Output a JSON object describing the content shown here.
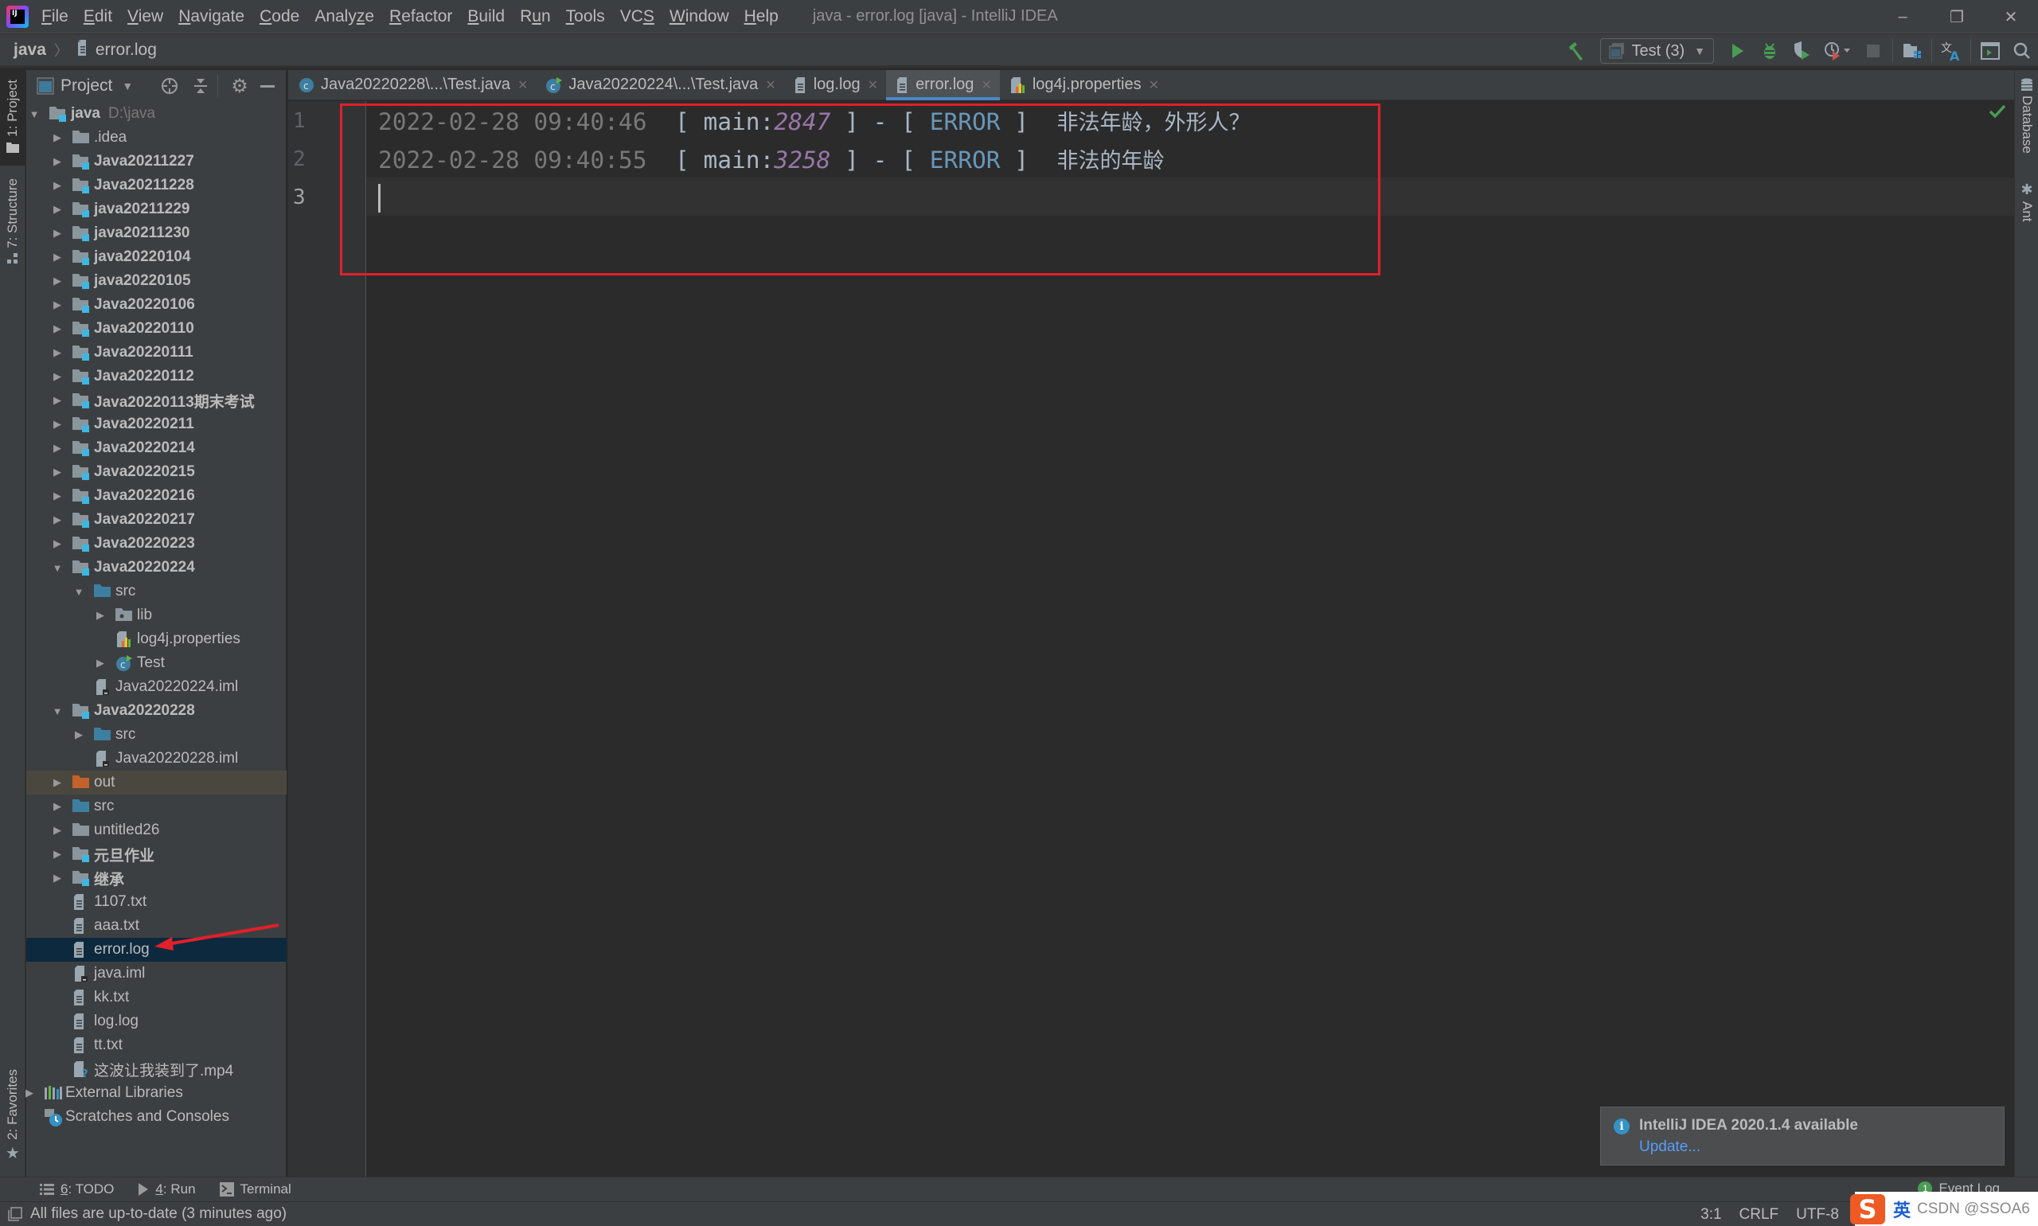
{
  "window": {
    "title": "java - error.log [java] - IntelliJ IDEA",
    "logo_text": "IJ",
    "controls": {
      "minimize": "–",
      "restore": "❐",
      "close": "✕"
    }
  },
  "menu": [
    {
      "label": "File",
      "mnemonic": "F",
      "rest": "ile"
    },
    {
      "label": "Edit",
      "mnemonic": "E",
      "rest": "dit"
    },
    {
      "label": "View",
      "mnemonic": "V",
      "rest": "iew"
    },
    {
      "label": "Navigate",
      "mnemonic": "N",
      "rest": "avigate"
    },
    {
      "label": "Code",
      "mnemonic": "C",
      "rest": "ode"
    },
    {
      "label": "Analyze",
      "pre": "Analy",
      "mnemonic": "z",
      "rest": "e"
    },
    {
      "label": "Refactor",
      "mnemonic": "R",
      "rest": "efactor"
    },
    {
      "label": "Build",
      "mnemonic": "B",
      "rest": "uild"
    },
    {
      "label": "Run",
      "pre": "R",
      "mnemonic": "u",
      "rest": "n"
    },
    {
      "label": "Tools",
      "mnemonic": "T",
      "rest": "ools"
    },
    {
      "label": "VCS",
      "pre": "VC",
      "mnemonic": "S",
      "rest": ""
    },
    {
      "label": "Window",
      "mnemonic": "W",
      "rest": "indow"
    },
    {
      "label": "Help",
      "mnemonic": "H",
      "rest": "elp"
    }
  ],
  "breadcrumb": {
    "root": "java",
    "separator": "〉",
    "file": "error.log"
  },
  "toolbar": {
    "run_config": "Test (3)",
    "icons": [
      "build-hammer-icon",
      "run-icon",
      "debug-icon",
      "coverage-icon",
      "profile-icon",
      "stop-icon",
      "project-structure-icon",
      "translate-icon",
      "terminal-window-icon",
      "search-icon"
    ]
  },
  "left_strip": {
    "project_tab": "1: Project",
    "structure_tab": "7: Structure",
    "favorites_tab": "2: Favorites"
  },
  "project_panel": {
    "title": "Project",
    "tree": [
      {
        "depth": 0,
        "label": "java",
        "hint": "D:\\java",
        "type": "module",
        "expanded": true,
        "bold": true
      },
      {
        "depth": 1,
        "label": ".idea",
        "type": "folder",
        "expandable": true
      },
      {
        "depth": 1,
        "label": "Java20211227",
        "type": "module",
        "expandable": true,
        "bold": true
      },
      {
        "depth": 1,
        "label": "Java20211228",
        "type": "module",
        "expandable": true,
        "bold": true
      },
      {
        "depth": 1,
        "label": "java20211229",
        "type": "module",
        "expandable": true,
        "bold": true
      },
      {
        "depth": 1,
        "label": "java20211230",
        "type": "module",
        "expandable": true,
        "bold": true
      },
      {
        "depth": 1,
        "label": "java20220104",
        "type": "module",
        "expandable": true,
        "bold": true
      },
      {
        "depth": 1,
        "label": "java20220105",
        "type": "module",
        "expandable": true,
        "bold": true
      },
      {
        "depth": 1,
        "label": "Java20220106",
        "type": "module",
        "expandable": true,
        "bold": true
      },
      {
        "depth": 1,
        "label": "Java20220110",
        "type": "module",
        "expandable": true,
        "bold": true
      },
      {
        "depth": 1,
        "label": "Java20220111",
        "type": "module",
        "expandable": true,
        "bold": true
      },
      {
        "depth": 1,
        "label": "Java20220112",
        "type": "module",
        "expandable": true,
        "bold": true
      },
      {
        "depth": 1,
        "label": "Java20220113期末考试",
        "type": "module",
        "expandable": true,
        "bold": true
      },
      {
        "depth": 1,
        "label": "Java20220211",
        "type": "module",
        "expandable": true,
        "bold": true
      },
      {
        "depth": 1,
        "label": "Java20220214",
        "type": "module",
        "expandable": true,
        "bold": true
      },
      {
        "depth": 1,
        "label": "Java20220215",
        "type": "module",
        "expandable": true,
        "bold": true
      },
      {
        "depth": 1,
        "label": "Java20220216",
        "type": "module",
        "expandable": true,
        "bold": true
      },
      {
        "depth": 1,
        "label": "Java20220217",
        "type": "module",
        "expandable": true,
        "bold": true
      },
      {
        "depth": 1,
        "label": "Java20220223",
        "type": "module",
        "expandable": true,
        "bold": true
      },
      {
        "depth": 1,
        "label": "Java20220224",
        "type": "module",
        "expanded": true,
        "bold": true
      },
      {
        "depth": 2,
        "label": "src",
        "type": "src",
        "expanded": true
      },
      {
        "depth": 3,
        "label": "lib",
        "type": "package",
        "expandable": true
      },
      {
        "depth": 3,
        "label": "log4j.properties",
        "type": "properties"
      },
      {
        "depth": 3,
        "label": "Test",
        "type": "class",
        "expandable": true
      },
      {
        "depth": 2,
        "label": "Java20220224.iml",
        "type": "iml"
      },
      {
        "depth": 1,
        "label": "Java20220228",
        "type": "module",
        "expanded": true,
        "bold": true
      },
      {
        "depth": 2,
        "label": "src",
        "type": "src",
        "expandable": true
      },
      {
        "depth": 2,
        "label": "Java20220228.iml",
        "type": "iml"
      },
      {
        "depth": 1,
        "label": "out",
        "type": "out",
        "expandable": true,
        "excluded": true
      },
      {
        "depth": 1,
        "label": "src",
        "type": "src",
        "expandable": true
      },
      {
        "depth": 1,
        "label": "untitled26",
        "type": "folder",
        "expandable": true
      },
      {
        "depth": 1,
        "label": "元旦作业",
        "type": "module",
        "expandable": true,
        "bold": true
      },
      {
        "depth": 1,
        "label": "继承",
        "type": "module",
        "expandable": true,
        "bold": true
      },
      {
        "depth": 1,
        "label": "1107.txt",
        "type": "text"
      },
      {
        "depth": 1,
        "label": "aaa.txt",
        "type": "text"
      },
      {
        "depth": 1,
        "label": "error.log",
        "type": "text",
        "selected": true
      },
      {
        "depth": 1,
        "label": "java.iml",
        "type": "iml"
      },
      {
        "depth": 1,
        "label": "kk.txt",
        "type": "text"
      },
      {
        "depth": 1,
        "label": "log.log",
        "type": "text"
      },
      {
        "depth": 1,
        "label": "tt.txt",
        "type": "text"
      },
      {
        "depth": 1,
        "label": "这波让我装到了.mp4",
        "type": "unknown"
      },
      {
        "depth": 0,
        "label": "External Libraries",
        "type": "libraries",
        "expandable": true
      },
      {
        "depth": 0,
        "label": "Scratches and Consoles",
        "type": "scratches"
      }
    ]
  },
  "tabs": [
    {
      "label": "Java20220228\\...\\Test.java",
      "icon": "class",
      "active": false
    },
    {
      "label": "Java20220224\\...\\Test.java",
      "icon": "class-run",
      "active": false
    },
    {
      "label": "log.log",
      "icon": "text",
      "active": false
    },
    {
      "label": "error.log",
      "icon": "text",
      "active": true
    },
    {
      "label": "log4j.properties",
      "icon": "properties",
      "active": false
    }
  ],
  "editor": {
    "lines": [
      {
        "number": "1",
        "timestamp": "2022-02-28 09:40:46",
        "thread": "main",
        "thread_id": "2847",
        "level": "ERROR",
        "message": "非法年龄，外形人？"
      },
      {
        "number": "2",
        "timestamp": "2022-02-28 09:40:55",
        "thread": "main",
        "thread_id": "3258",
        "level": "ERROR",
        "message": "非法的年龄"
      },
      {
        "number": "3"
      }
    ],
    "current_line": 3
  },
  "right_strip": {
    "database_tab": "Database",
    "ant_tab": "Ant"
  },
  "notification": {
    "title": "IntelliJ IDEA 2020.1.4 available",
    "link": "Update...",
    "icon": "i"
  },
  "tool_windows": [
    {
      "label": "6: TODO",
      "mnemonic": "6",
      "rest": ": TODO",
      "icon": "todo-icon"
    },
    {
      "label": "4: Run",
      "mnemonic": "4",
      "rest": ": Run",
      "icon": "run-icon"
    },
    {
      "label": "Terminal",
      "mnemonic": "",
      "rest": "Terminal",
      "icon": "terminal-icon"
    }
  ],
  "event_log": {
    "count": "1",
    "label": "Event Log"
  },
  "status": {
    "message": "All files are up-to-date (3 minutes ago)",
    "position": "3:1",
    "line_separator": "CRLF",
    "encoding": "UTF-8"
  },
  "ime": {
    "logo": "S",
    "lang": "英",
    "watermark": "CSDN @SSOA6",
    "icons": "• 🎤 ⌨ ⊞"
  },
  "colors": {
    "annotation": "#e0202a",
    "accent_tab": "#4a88c7",
    "thread_id": "#9876aa",
    "level": "#6897bb",
    "selection": "#0d293e"
  }
}
